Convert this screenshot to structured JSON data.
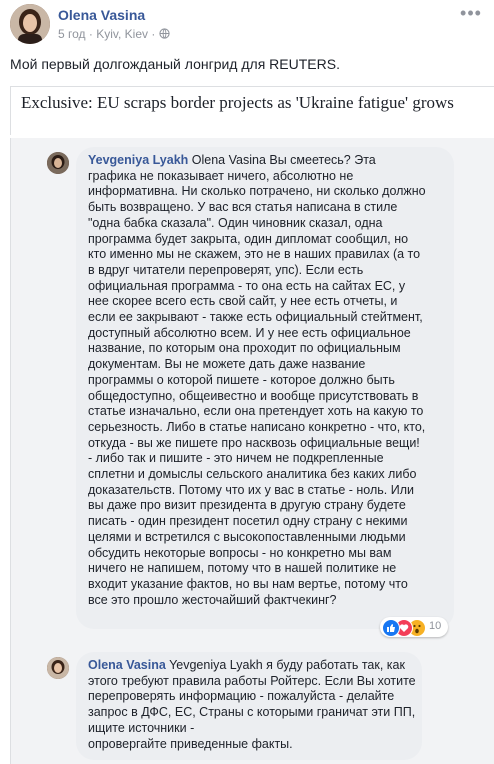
{
  "post": {
    "author": "Olena Vasina",
    "time": "5 год",
    "location": "Kyiv, Kiev",
    "text": "Мой первый долгожданый лонгрид для REUTERS.",
    "link_title": "Exclusive: EU scraps border projects as 'Ukraine fatigue' grows"
  },
  "comments": [
    {
      "author": "Yevgeniya Lyakh",
      "text": "Olena Vasina Вы смеетесь? Эта\nграфика не показывает ничего, абсолютно не\nинформативна. Ни сколько потрачено, ни сколько должно\nбыть возвращено. У вас вся статья написана в стиле\n\"одна бабка сказала\". Один чиновник сказал, одна\nпрограмма будет закрыта, один дипломат сообщил, но\nкто именно мы не скажем, это не в наших правилах (а то\nв вдруг читатели перепроверят, упс). Если есть\nофициальная программа - то она есть на сайтах ЕС, у\nнее скорее всего есть свой сайт, у нее есть отчеты, и\nесли ее закрывают - также есть официальный стейтмент,\nдоступный абсолютно всем. И у нее есть официальное\nназвание, по которым она проходит по официальным\nдокументам. Вы не можете дать даже название\nпрограммы о которой пишете - которое должно быть\nобщедоступно, общеивестно и вообще присутствовать в\nстатье изначально, если она претендует хоть на какую то\nсерьезность. Либо в статье написано конкретно - что, кто,\nоткуда - вы же пишете про насквозь официальные вещи!\n- либо так и пишите - это ничем не подкрепленные\nсплетни и домыслы сельского аналитика без каких либо\nдоказательств. Потому что их у вас в статье - ноль. Или\nвы даже про визит президента в другую страну будете\nписать - один президент посетил одну страну с некими\nцелями и встретился с высокопоставленными людьми\nобсудить некоторые вопросы - но конкретно мы вам\nничего не напишем, потому что в нашей политике не\nвходит указание фактов, но вы нам вертье, потому что\nвсе это прошло жесточайший фактчекинг?",
      "reaction_count": "10"
    },
    {
      "author": "Olena Vasina",
      "text": "Yevgeniya Lyakh я буду работать так, как\nэтого требуют правила работы Ройтерс. Если Вы хотите\nперепроверять информацию - пожалуйста - делайте\nзапрос в ДФС, ЕС, Страны с которыми граничат эти ПП,\nищите источники -\nопровергайте приведенные факты."
    }
  ],
  "colors": {
    "name_link": "#385898",
    "meta_gray": "#90949c",
    "bubble_bg": "#eceef1",
    "comments_bg": "#f2f3f5",
    "like_blue": "#1877f2",
    "love_red": "#f33e58",
    "wow_yellow": "#f7b125"
  },
  "icons": [
    "more-icon",
    "globe-icon",
    "like-reaction-icon",
    "love-reaction-icon",
    "wow-reaction-icon"
  ]
}
